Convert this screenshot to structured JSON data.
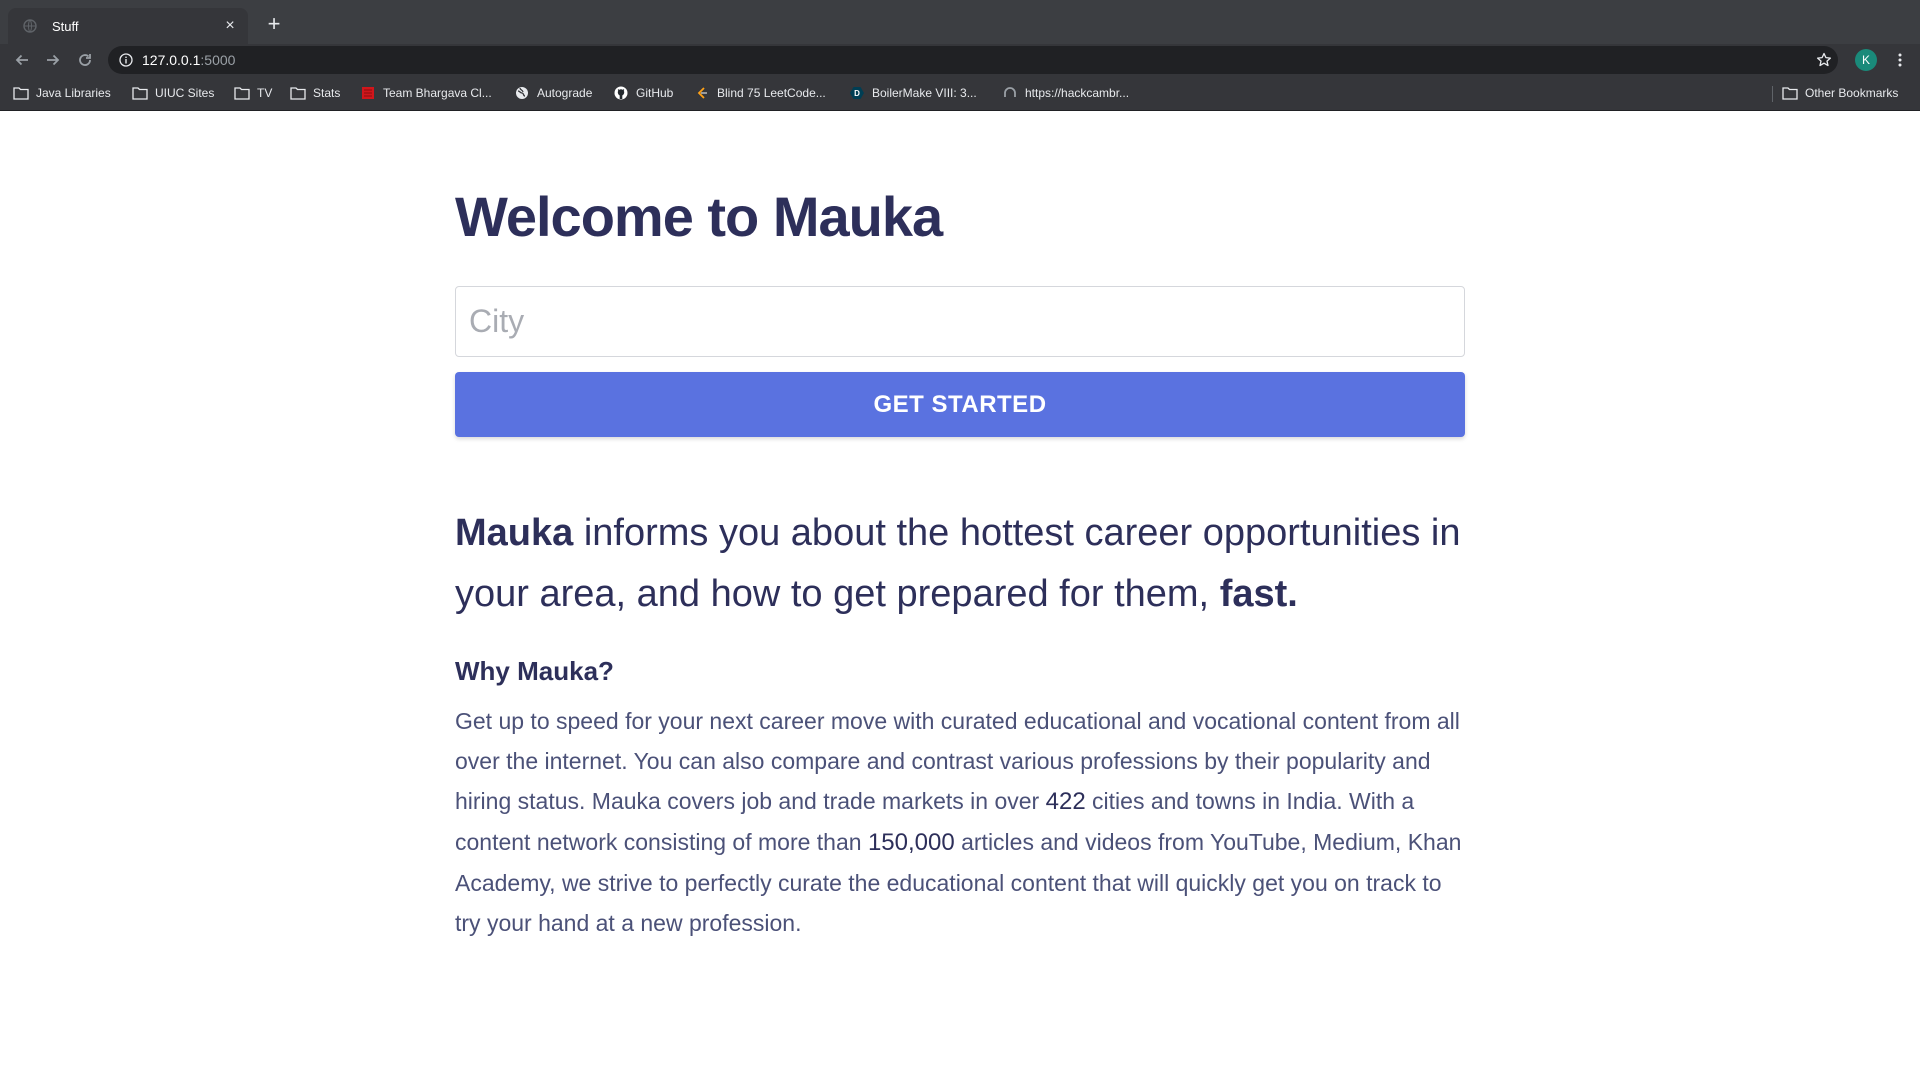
{
  "browser": {
    "tab": {
      "title": "Stuff",
      "close": "×"
    },
    "new_tab": "+",
    "url": {
      "host": "127.0.0.1",
      "port": ":5000"
    },
    "profile_initial": "K",
    "bookmarks": [
      {
        "label": "Java Libraries",
        "icon": "folder-icon"
      },
      {
        "label": "UIUC Sites",
        "icon": "folder-icon"
      },
      {
        "label": "TV",
        "icon": "folder-icon"
      },
      {
        "label": "Stats",
        "icon": "folder-icon"
      },
      {
        "label": "Team Bhargava Cl...",
        "icon": "red-site-icon"
      },
      {
        "label": "Autograde",
        "icon": "globe-icon"
      },
      {
        "label": "GitHub",
        "icon": "github-icon"
      },
      {
        "label": "Blind 75 LeetCode...",
        "icon": "leetcode-icon"
      },
      {
        "label": "BoilerMake VIII: 3...",
        "icon": "devpost-icon"
      },
      {
        "label": "https://hackcambr...",
        "icon": "site-icon"
      }
    ],
    "other_bookmarks": "Other Bookmarks",
    "colors": {
      "tabstrip": "#3c3e42",
      "toolbar": "#35363a",
      "omnibox": "#202124",
      "avatar": "#1a8a7a"
    }
  },
  "page": {
    "headline_prefix": "Welcome to ",
    "headline_brand": "Mauka",
    "city_placeholder": "City",
    "cta_label": "GET STARTED",
    "lead": {
      "brand": "Mauka",
      "middle": " informs you about the hottest career opportunities in your area, and how to get prepared for them, ",
      "emphasis": "fast."
    },
    "why_heading": "Why Mauka?",
    "body": {
      "part1": "Get up to speed for your next career move with curated educational and vocational content from all over the internet. You can also compare and contrast various professions by their popularity and hiring status. Mauka covers job and trade markets in over ",
      "cities_count": "422",
      "part2": " cities and towns in India. With a content network consisting of more than ",
      "articles_count": "150,000",
      "part3": " articles and videos from YouTube, Medium, Khan Academy, we strive to perfectly curate the educational content that will quickly get you on track to try your hand at a new profession."
    },
    "colors": {
      "heading": "#2d2f5a",
      "body": "#4b5178",
      "button": "#5a72e0"
    }
  }
}
